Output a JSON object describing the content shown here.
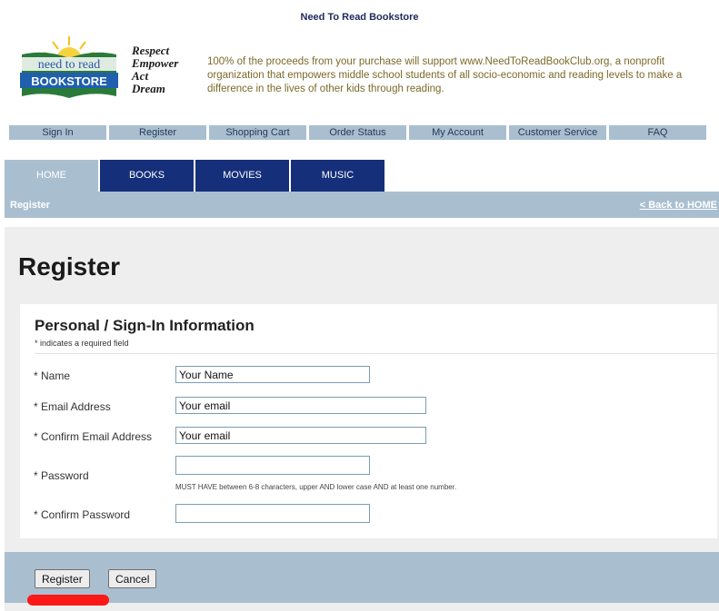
{
  "header": {
    "store_name": "Need To Read Bookstore",
    "logo": {
      "line1": "need to read",
      "line2": "BOOKSTORE"
    },
    "motto": [
      "Respect",
      "Empower",
      "Act",
      "Dream"
    ],
    "mission": "100% of the proceeds from your purchase will support www.NeedToReadBookClub.org, a nonprofit organization that empowers middle school students of all socio-economic and reading levels to make a difference in the lives of other kids through reading."
  },
  "topnav": [
    "Sign In",
    "Register",
    "Shopping Cart",
    "Order Status",
    "My Account",
    "Customer Service",
    "FAQ"
  ],
  "tabs": [
    {
      "label": "HOME",
      "active": true
    },
    {
      "label": "BOOKS",
      "active": false
    },
    {
      "label": "MOVIES",
      "active": false
    },
    {
      "label": "MUSIC",
      "active": false
    }
  ],
  "breadcrumb": {
    "current": "Register",
    "back_link": "< Back to HOME"
  },
  "page": {
    "title": "Register",
    "section_title": "Personal / Sign-In Information",
    "required_note": "* indicates a required field"
  },
  "form": {
    "name": {
      "label": "* Name",
      "value": "Your Name"
    },
    "email": {
      "label": "* Email Address",
      "value": "Your email"
    },
    "confirm_email": {
      "label": "* Confirm Email Address",
      "value": "Your email"
    },
    "password": {
      "label": "* Password",
      "value": "",
      "hint": "MUST HAVE between 6-8 characters, upper AND lower case AND at least one number."
    },
    "confirm_password": {
      "label": "* Confirm Password",
      "value": ""
    }
  },
  "buttons": {
    "register": "Register",
    "cancel": "Cancel"
  },
  "colors": {
    "nav_blue": "#162f7a",
    "light_blue": "#a9bfd0",
    "annotation_red": "#ff1818"
  }
}
